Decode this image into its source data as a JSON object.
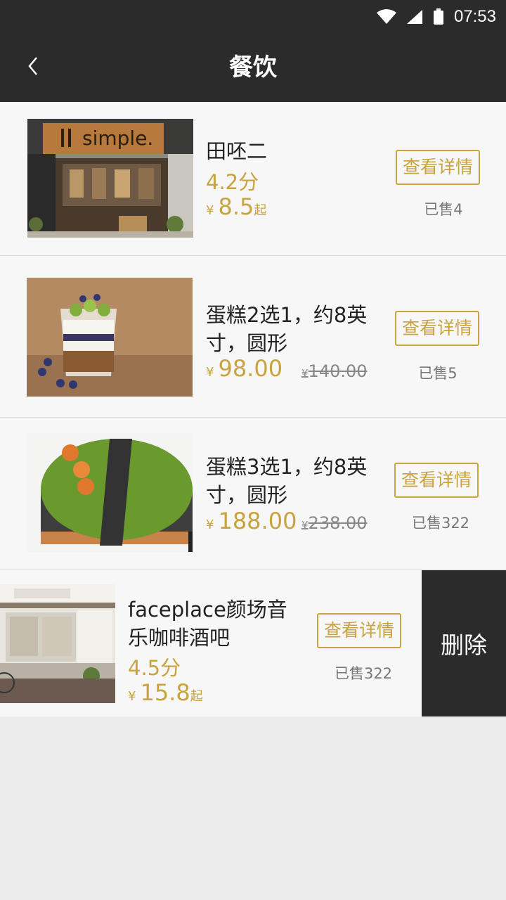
{
  "status_bar": {
    "time": "07:53"
  },
  "header": {
    "title": "餐饮"
  },
  "items": [
    {
      "name": "田呸二",
      "score": "4.2分",
      "currency": "¥",
      "price": "8.5",
      "price_suffix": "起",
      "detail_label": "查看详情",
      "sold": "已售4"
    },
    {
      "name": "蛋糕2选1，约8英寸，圆形",
      "currency": "¥",
      "price": "98.00",
      "orig_currency": "¥",
      "orig_price": "140.00",
      "detail_label": "查看详情",
      "sold": "已售5"
    },
    {
      "name": "蛋糕3选1，约8英寸，圆形",
      "currency": "¥",
      "price": "188.00",
      "orig_currency": "¥",
      "orig_price": "238.00",
      "detail_label": "查看详情",
      "sold": "已售322"
    },
    {
      "name": "faceplace颜场音乐咖啡酒吧",
      "score": "4.5分",
      "currency": "¥",
      "price": "15.8",
      "price_suffix": "起",
      "detail_label": "查看详情",
      "sold": "已售322",
      "delete_label": "删除"
    }
  ],
  "thumb_texts": {
    "store_sign": "simple."
  }
}
